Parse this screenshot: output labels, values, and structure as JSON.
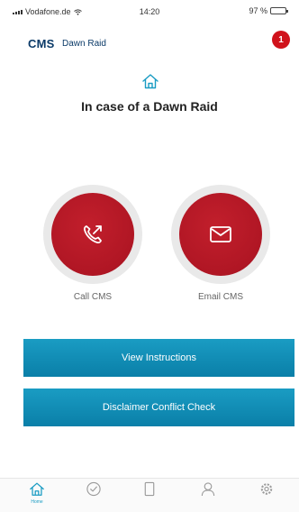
{
  "status_bar": {
    "carrier": "Vodafone.de",
    "time": "14:20",
    "battery": "97 %",
    "battery_level": 0.97
  },
  "header": {
    "brand": "CMS",
    "brand_sub": "Dawn Raid",
    "badge_count": "1"
  },
  "main": {
    "title": "In case of a Dawn Raid"
  },
  "actions": [
    {
      "label": "Call CMS",
      "icon": "phone-outgoing-icon"
    },
    {
      "label": "Email CMS",
      "icon": "envelope-icon"
    }
  ],
  "buttons": {
    "view_instructions": "View Instructions",
    "disclaimer": "Disclaimer Conflict Check"
  },
  "tabs": [
    {
      "label": "Home",
      "icon": "home-icon",
      "active": true
    },
    {
      "label": "",
      "icon": "checkmark-circle-icon"
    },
    {
      "label": "",
      "icon": "document-icon"
    },
    {
      "label": "",
      "icon": "person-icon"
    },
    {
      "label": "",
      "icon": "gear-icon"
    }
  ],
  "colors": {
    "accent_red": "#b01624",
    "accent_blue": "#0a7fa8",
    "brand_navy": "#0a3a68"
  }
}
